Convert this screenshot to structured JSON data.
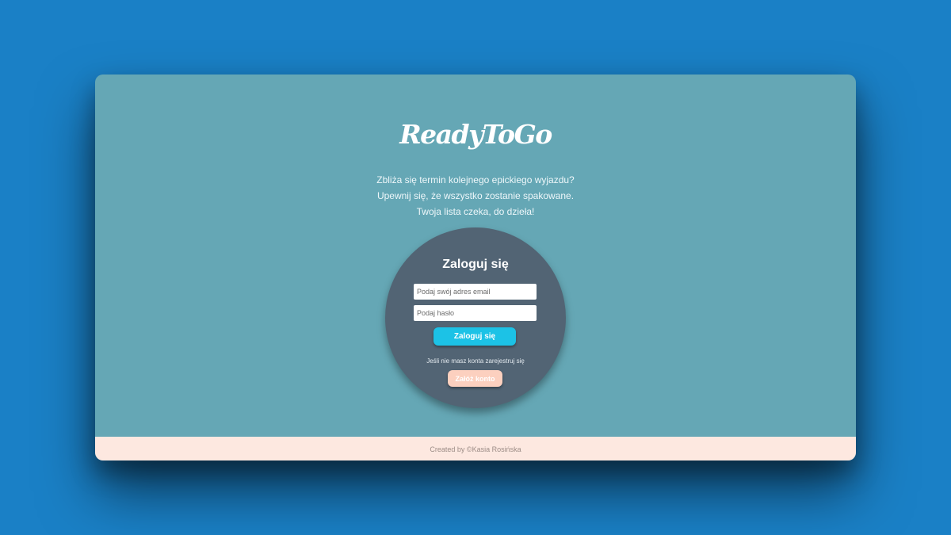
{
  "app": {
    "logo": "ReadyToGo",
    "tagline": [
      "Zbliża się termin kolejnego epickiego wyjazdu?",
      "Upewnij się, że wszystko zostanie spakowane.",
      "Twoja lista czeka, do dzieła!"
    ]
  },
  "login": {
    "title": "Zaloguj się",
    "email_placeholder": "Podaj swój adres email",
    "email_value": "",
    "password_placeholder": "Podaj hasło",
    "password_value": "",
    "submit_label": "Zaloguj się",
    "register_hint": "Jeśli nie masz konta zarejestruj się",
    "register_label": "Załóż konto"
  },
  "footer": {
    "credit": "Created by ©Kasia Rosińska"
  },
  "colors": {
    "page_background": "#1a80c6",
    "main_background": "#65a7b5",
    "login_circle": "#526474",
    "login_button": "#1cc2e6",
    "register_button": "#fcd0bf",
    "footer_background": "#fde8e0"
  }
}
